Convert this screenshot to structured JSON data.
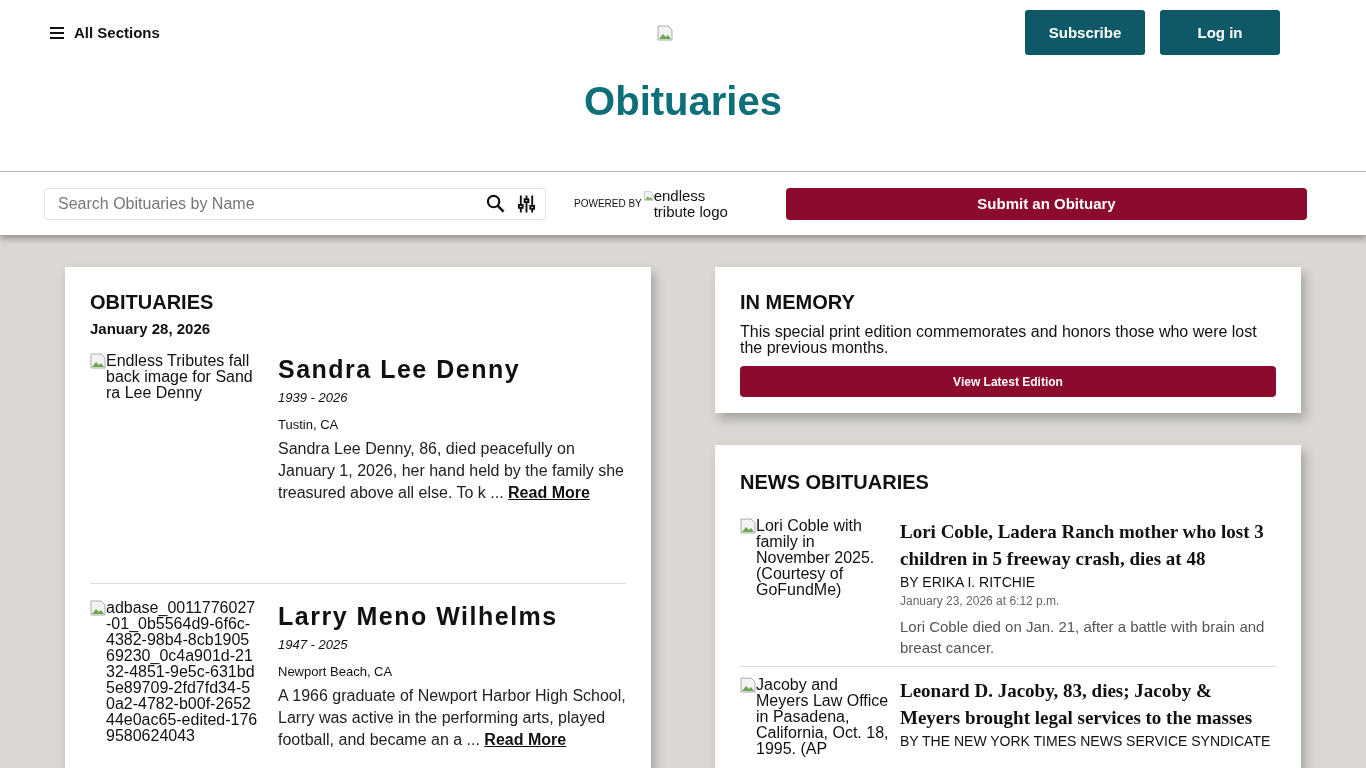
{
  "header": {
    "menu_label": "All Sections",
    "title": "Obituaries",
    "buttons": [
      {
        "label": "Subscribe"
      },
      {
        "label": "Log in"
      }
    ]
  },
  "search_bar": {
    "placeholder": "Search Obituaries by Name",
    "powered_by": "POWERED BY",
    "partner_logo_alt": "endless tribute logo",
    "submit_button": "Submit an Obituary"
  },
  "obituaries": {
    "heading": "OBITUARIES",
    "date": "January 28, 2026",
    "items": [
      {
        "image_alt": "Endless Tributes fallback image for Sandra Lee Denny",
        "name": "Sandra Lee Denny",
        "years": "1939 - 2026",
        "location": "Tustin, CA",
        "excerpt": "Sandra Lee Denny, 86, died peacefully on January 1, 2026, her hand held by the family she treasured above all else. To k ...",
        "link": "Read More"
      },
      {
        "image_alt": "adbase_0011776027-01_0b5564d9-6f6c-4382-98b4-8cb190569230_0c4a901d-2132-4851-9e5c-631bd5e89709-2fd7fd34-50a2-4782-b00f-265244e0ac65-edited-1769580624043",
        "name": "Larry Meno Wilhelms",
        "years": "1947 - 2025",
        "location": "Newport Beach, CA",
        "excerpt": "A 1966 graduate of Newport Harbor High School, Larry was active in the performing arts, played football, and became an a ...",
        "link": "Read More"
      }
    ]
  },
  "in_memory": {
    "heading": "IN MEMORY",
    "text": "This special print edition commemorates and honors those who were lost the previous months.",
    "button": "View Latest Edition"
  },
  "news_obituaries": {
    "heading": "NEWS OBITUARIES",
    "items": [
      {
        "image_alt": "Lori Coble with family in November 2025. (Courtesy of GoFundMe)",
        "headline": "Lori Coble, Ladera Ranch mother who lost 3 children in 5 freeway crash, dies at 48",
        "byline": "BY ERIKA I. RITCHIE",
        "date": "January 23, 2026 at 6:12 p.m.",
        "summary": "Lori Coble died on Jan. 21, after a battle with brain and breast cancer."
      },
      {
        "image_alt": "Jacoby and Meyers Law Office in Pasadena, California, Oct. 18, 1995. (AP",
        "headline": "Leonard D. Jacoby, 83, dies; Jacoby & Meyers brought legal services to the masses",
        "byline": "BY THE NEW YORK TIMES NEWS SERVICE SYNDICATE"
      }
    ]
  }
}
